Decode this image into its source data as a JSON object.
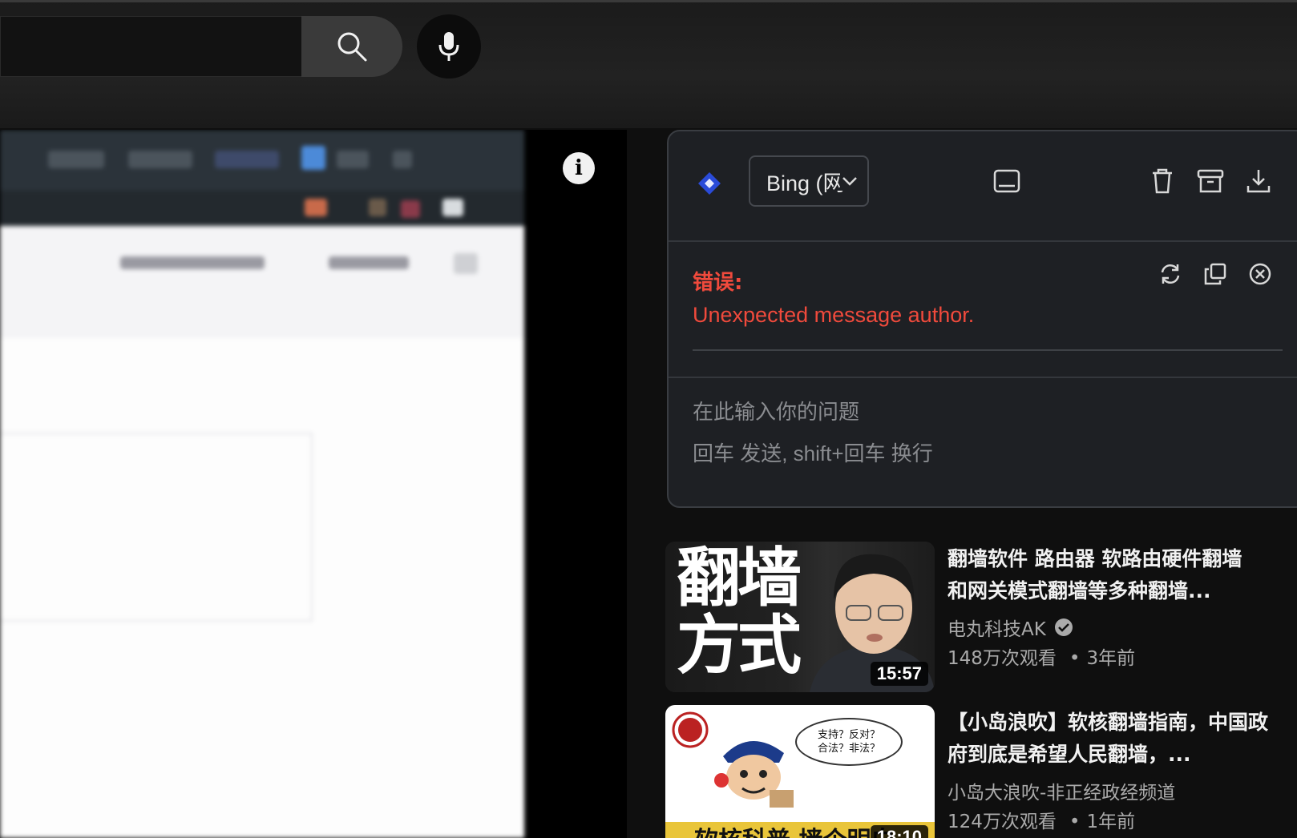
{
  "masthead": {
    "search": {
      "placeholder": ""
    },
    "search_icon": "search-icon",
    "mic_icon": "microphone-icon"
  },
  "player": {
    "info_glyph": "i"
  },
  "chat": {
    "model_select": {
      "value": "Bing (网"
    },
    "header_icons": [
      "window-icon",
      "trash-icon",
      "archive-icon",
      "download-icon"
    ],
    "message": {
      "label": "错误:",
      "text": "Unexpected message author.",
      "actions": [
        "refresh-icon",
        "copy-icon",
        "close-circle-icon"
      ]
    },
    "input": {
      "placeholder_line1": "在此输入你的问题",
      "placeholder_line2": "回车 发送, shift+回车 换行"
    },
    "colors": {
      "error": "#f04a3c",
      "panel_bg": "#1e2024",
      "bing_blue": "#2a4bd8"
    }
  },
  "recommendations": [
    {
      "title": "翻墙软件 路由器 软路由硬件翻墙 和网关模式翻墙等多种翻墙...",
      "channel": "电丸科技AK",
      "verified": true,
      "views": "148万次观看",
      "age": "3年前",
      "duration": "15:57",
      "thumb_text": "翻墙方式"
    },
    {
      "title": "【小岛浪吹】软核翻墙指南，中国政府到底是希望人民翻墙，...",
      "channel": "小岛大浪吹-非正经政经频道",
      "verified": false,
      "views": "124万次观看",
      "age": "1年前",
      "duration": "18:10",
      "thumb_text": "软核科普 墙个明白",
      "bubble_line1": "支持？反对？",
      "bubble_line2": "合法？非法？"
    }
  ]
}
